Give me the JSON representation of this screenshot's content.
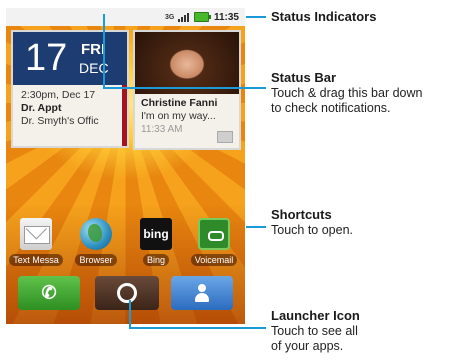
{
  "status_bar": {
    "network": "3G",
    "time": "11:35"
  },
  "calendar_widget": {
    "day": "17",
    "weekday": "FRI",
    "month": "DEC",
    "event_time": "2:30pm, Dec 17",
    "event_title": "Dr. Appt",
    "event_location": "Dr. Smyth's Offic"
  },
  "contact_widget": {
    "name": "Christine Fanni",
    "message": "I'm on my way...",
    "time": "11:33 AM"
  },
  "shortcuts": [
    {
      "label": "Text Messa",
      "icon": "text-message-icon"
    },
    {
      "label": "Browser",
      "icon": "globe-icon"
    },
    {
      "label": "Bing",
      "icon": "bing-icon",
      "glyph": "bing"
    },
    {
      "label": "Voicemail",
      "icon": "voicemail-icon"
    }
  ],
  "dock": {
    "phone_glyph": "✆"
  },
  "callouts": {
    "status_indicators": {
      "title": "Status Indicators"
    },
    "status_bar": {
      "title": "Status Bar",
      "line1": "Touch & drag this bar down",
      "line2": "to check notifications."
    },
    "shortcuts": {
      "title": "Shortcuts",
      "line1": "Touch to open."
    },
    "launcher": {
      "title": "Launcher Icon",
      "line1": "Touch to see all",
      "line2": "of your apps."
    }
  },
  "colors": {
    "callout_line": "#1a9ad6",
    "calendar_accent": "#1d3d72"
  }
}
